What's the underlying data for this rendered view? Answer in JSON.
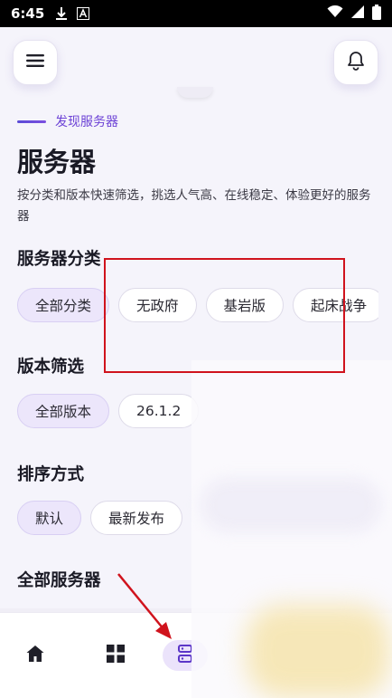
{
  "status_bar": {
    "time": "6:45",
    "icons_left": [
      "download-icon",
      "a-icon"
    ],
    "icons_right": [
      "wifi-icon",
      "signal-icon",
      "battery-icon"
    ]
  },
  "header": {
    "menu_icon": "menu-icon",
    "bell_icon": "bell-icon"
  },
  "page": {
    "eyebrow": "发现服务器",
    "title": "服务器",
    "description": "按分类和版本快速筛选，挑选人气高、在线稳定、体验更好的服务器"
  },
  "category": {
    "title": "服务器分类",
    "chips": [
      "全部分类",
      "无政府",
      "基岩版",
      "起床战争"
    ],
    "active_index": 0
  },
  "version": {
    "title": "版本筛选",
    "chips": [
      "全部版本",
      "26.1.2"
    ],
    "active_index": 0
  },
  "sort": {
    "title": "排序方式",
    "chips": [
      "默认",
      "最新发布"
    ],
    "active_index": 0
  },
  "all_servers": {
    "title": "全部服务器"
  },
  "bottom_nav": {
    "items": [
      {
        "icon": "home-icon"
      },
      {
        "icon": "grid-icon"
      },
      {
        "icon": "server-icon",
        "active": true
      }
    ]
  },
  "colors": {
    "accent": "#6d43d6",
    "chip_active_bg": "#ece6fb",
    "annotation_red": "#d0131d"
  }
}
